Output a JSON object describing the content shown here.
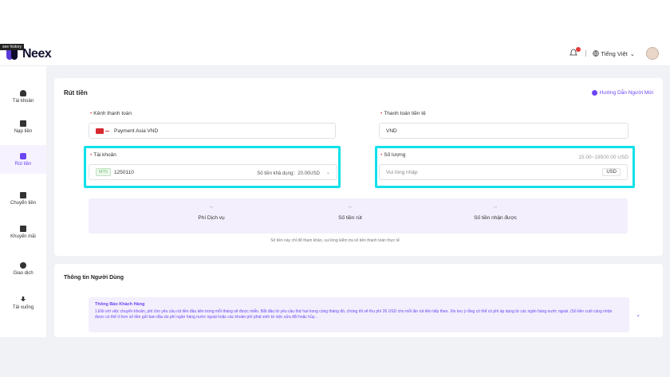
{
  "header": {
    "logo_text": "Neex",
    "see_history": "see history",
    "language": "Tiếng Việt",
    "icons": [
      "bell-icon",
      "globe-icon",
      "chevron-down-icon"
    ]
  },
  "sidebar": {
    "items": [
      {
        "label": "Tài khoản",
        "icon": "user-icon"
      },
      {
        "label": "Nạp tiền",
        "icon": "deposit-icon"
      },
      {
        "label": "Rút tiền",
        "icon": "withdraw-icon",
        "active": true
      },
      {
        "label": "Chuyển tiền",
        "icon": "transfer-icon"
      },
      {
        "label": "Khuyến mãi",
        "icon": "promo-icon"
      },
      {
        "label": "Giao dịch",
        "icon": "trade-icon"
      },
      {
        "label": "Tải xuống",
        "icon": "download-icon"
      }
    ]
  },
  "main": {
    "title": "Rút tiền",
    "guide_link": "Hướng Dẫn Người Mới",
    "channel_label": "Kênh thanh toán",
    "channel_value": "Payment Asia VND",
    "currency_label": "Thanh toán tiền tệ",
    "currency_value": "VND",
    "account_label": "Tài khoản",
    "account_tag": "MT5",
    "account_value": "1250110",
    "available": "Số tiền khả dụng：20.00USD",
    "amount_label": "Số lượng",
    "amount_range": "15.00~19500.00 USD",
    "amount_placeholder": "Vui lòng nhập",
    "amount_unit": "USD",
    "summary": [
      {
        "value": "--",
        "label": "Phí Dịch vụ"
      },
      {
        "value": "--",
        "label": "Số tiền rút"
      },
      {
        "value": "--",
        "label": "Số tiền nhận được"
      }
    ],
    "note": "Số tiền này chỉ để tham khảo, vui lòng kiểm tra số tiền thanh toán thực tế"
  },
  "info": {
    "title": "Thông tin Người Dùng",
    "notice_title": "Thông Báo Khách Hàng",
    "notice_body": "1.Đối với việc chuyển khoản, phí cho yêu cầu rút tiền đầu tiên trong mỗi tháng sẽ được miễn. Bắt đầu từ yêu cầu thứ hai trong cùng tháng đó, chúng tôi sẽ thu phí 26 USD cho mỗi lần rút tiền tiếp theo. Xin lưu ý rằng có thể có phí áp dụng từ các ngân hàng nước ngoài. (Số tiền cuối cùng nhận được có thể ít hơn số tiền gửi ban đầu do phí ngân hàng nước ngoài hoặc các khoản phí phát sinh từ việc sửa đổi hoặc hủy..."
  },
  "colors": {
    "accent": "#6c45f5",
    "highlight": "#10e0e8"
  }
}
